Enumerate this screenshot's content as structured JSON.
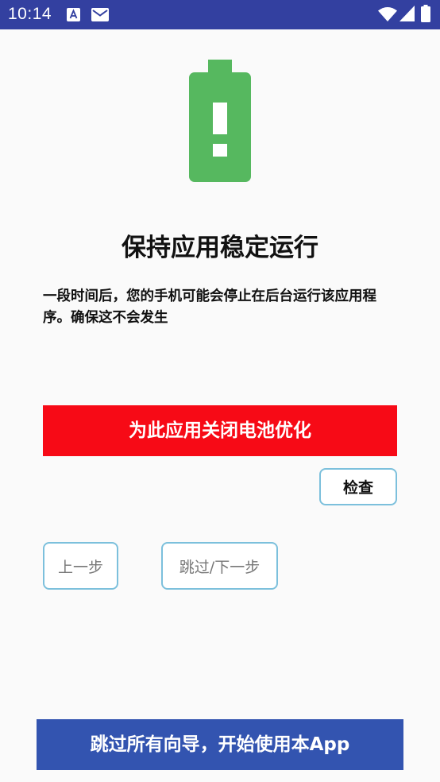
{
  "status_bar": {
    "time": "10:14",
    "icons": [
      "translate-icon",
      "mail-icon",
      "wifi-icon",
      "signal-icon",
      "battery-icon"
    ],
    "color": "#3340a0"
  },
  "hero": {
    "icon": "battery-alert-icon",
    "color": "#56b85f"
  },
  "title": "保持应用稳定运行",
  "description": "一段时间后，您的手机可能会停止在后台运行该应用程序。确保这不会发生",
  "buttons": {
    "disable_optimization": "为此应用关闭电池优化",
    "check": "检查",
    "previous": "上一步",
    "skip_next": "跳过/下一步",
    "skip_all": "跳过所有向导，开始使用本App"
  },
  "colors": {
    "danger": "#f70a16",
    "primary": "#3354b0",
    "outline": "#7cc0dc"
  }
}
